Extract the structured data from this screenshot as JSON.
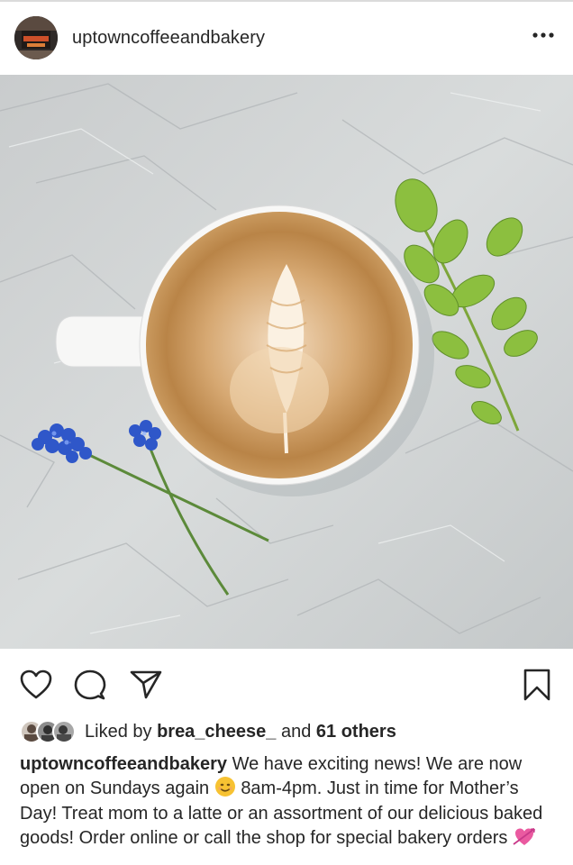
{
  "post": {
    "username": "uptowncoffeeandbakery",
    "avatar_text": "UPTOWN COFFEE",
    "more_icon": "more-horizontal-icon",
    "photo_alt": "Latte art in a white mug next to blue flowers and green leaves"
  },
  "actions": {
    "like_icon": "heart-icon",
    "comment_icon": "comment-icon",
    "share_icon": "send-icon",
    "save_icon": "bookmark-icon"
  },
  "likes": {
    "prefix": "Liked by",
    "user": "brea_cheese_",
    "middle": "and",
    "others": "61 others"
  },
  "caption": {
    "username": "uptowncoffeeandbakery",
    "part1": "We have exciting news! We are now open on Sundays again",
    "part2": "8am-4pm. Just in time for Mother’s Day! Treat mom to a latte or an assortment of our delicious baked goods! Order online or call the shop for special bakery orders",
    "emoji1": "smiling-face-emoji",
    "emoji2": "heart-with-arrow-emoji"
  },
  "colors": {
    "text": "#262626",
    "divider": "#dbdbdb",
    "background": "#ffffff"
  }
}
